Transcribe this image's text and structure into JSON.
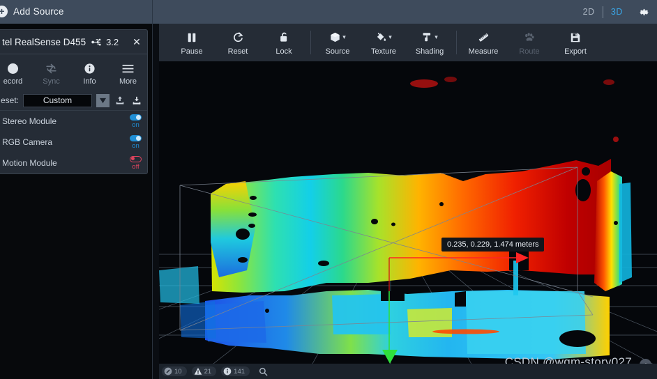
{
  "topbar": {
    "add_source_label": "Add Source",
    "add_source_icon": "plus-circle-icon",
    "view_2d": "2D",
    "view_3d": "3D",
    "settings_icon": "gear-icon",
    "active_view": "3D",
    "bg_color": "#3e4b5c",
    "accent_color": "#3aa7e8"
  },
  "device_panel": {
    "name": "tel RealSense D455",
    "usb_icon": "usb-icon",
    "usb_version": "3.2",
    "close_label": "✕",
    "actions": [
      {
        "label": "ecord",
        "icon": "record-dot-icon",
        "enabled": true
      },
      {
        "label": "Sync",
        "icon": "sync-icon",
        "enabled": false
      },
      {
        "label": "Info",
        "icon": "info-icon",
        "enabled": true
      },
      {
        "label": "More",
        "icon": "hamburger-icon",
        "enabled": true
      }
    ],
    "preset": {
      "label": "eset:",
      "value": "Custom",
      "caret_icon": "caret-down-icon",
      "import_icon": "upload-icon",
      "export_icon": "download-icon"
    },
    "modules": [
      {
        "name": "Stereo Module",
        "state": "on",
        "state_label": "on"
      },
      {
        "name": "RGB Camera",
        "state": "on",
        "state_label": "on"
      },
      {
        "name": "Motion Module",
        "state": "off",
        "state_label": "off"
      }
    ],
    "toggle_on_color": "#1f8fd6",
    "toggle_off_color": "#e0445e"
  },
  "viewport_toolbar": {
    "buttons": [
      {
        "label": "Pause",
        "icon": "pause-icon",
        "dropdown": false,
        "enabled": true,
        "sep_after": false
      },
      {
        "label": "Reset",
        "icon": "reset-icon",
        "dropdown": false,
        "enabled": true,
        "sep_after": false
      },
      {
        "label": "Lock",
        "icon": "unlock-icon",
        "dropdown": false,
        "enabled": true,
        "sep_after": true
      },
      {
        "label": "Source",
        "icon": "cube-icon",
        "dropdown": true,
        "enabled": true,
        "sep_after": false
      },
      {
        "label": "Texture",
        "icon": "paint-can-icon",
        "dropdown": true,
        "enabled": true,
        "sep_after": false
      },
      {
        "label": "Shading",
        "icon": "roller-icon",
        "dropdown": true,
        "enabled": true,
        "sep_after": true
      },
      {
        "label": "Measure",
        "icon": "ruler-icon",
        "dropdown": false,
        "enabled": true,
        "sep_after": false
      },
      {
        "label": "Route",
        "icon": "paw-icon",
        "dropdown": false,
        "enabled": false,
        "sep_after": false
      },
      {
        "label": "Export",
        "icon": "save-icon",
        "dropdown": false,
        "enabled": true,
        "sep_after": false
      }
    ]
  },
  "viewport": {
    "tooltip": "0.235, 0.229, 1.474 meters",
    "watermark": "CSDN @wqm-story027",
    "collapse_icon": "chevron-up-icon",
    "axis_y_color": "#2fe03c",
    "axis_x_color": "#ff2222"
  },
  "statusbar": {
    "chips": [
      {
        "icon": "cancel-icon",
        "count": "10",
        "name": "errors"
      },
      {
        "icon": "warning-icon",
        "count": "21",
        "name": "warnings"
      },
      {
        "icon": "info-icon",
        "count": "141",
        "name": "infos"
      }
    ],
    "search_icon": "search-icon"
  }
}
